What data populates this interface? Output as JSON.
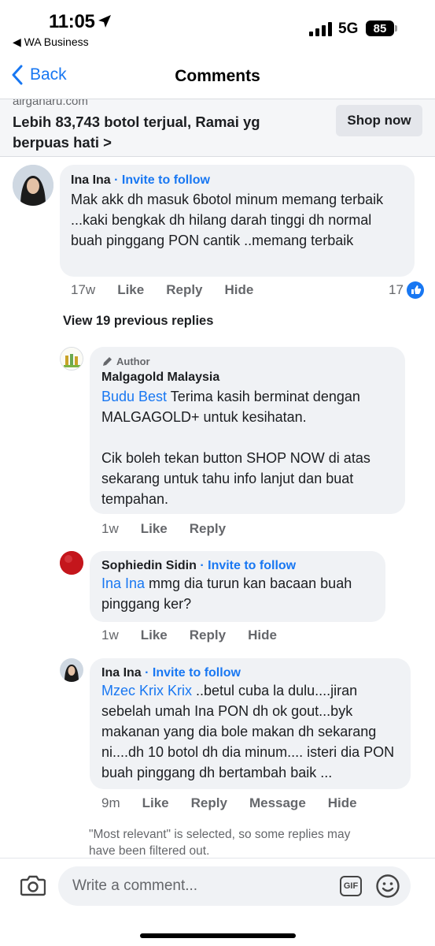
{
  "status_bar": {
    "time": "11:05",
    "back_app": "◀ WA Business",
    "network": "5G",
    "battery": "85"
  },
  "nav": {
    "back_label": "Back",
    "title": "Comments"
  },
  "ad": {
    "domain": "airganaru.com",
    "headline": "Lebih 83,743 botol terjual, Ramai yg berpuas hati  >",
    "button": "Shop now"
  },
  "comments": [
    {
      "name": "Ina Ina",
      "follow": "· Invite to follow",
      "text": "Mak akk dh masuk 6botol minum memang terbaik ...kaki bengkak dh hilang darah tinggi dh normal buah pinggang PON cantik ..memang terbaik",
      "time": "17w",
      "actions": [
        "Like",
        "Reply",
        "Hide"
      ],
      "like_count": "17"
    }
  ],
  "view_replies": "View 19 previous replies",
  "replies": [
    {
      "badge": "Author",
      "name": "Malgagold Malaysia",
      "mention": "Budu Best",
      "text_1": " Terima kasih berminat dengan MALGAGOLD+ untuk kesihatan.",
      "text_2": "Cik boleh tekan button SHOP NOW di atas sekarang untuk tahu info lanjut dan buat tempahan.",
      "time": "1w",
      "actions": [
        "Like",
        "Reply"
      ]
    },
    {
      "name": "Sophiedin Sidin",
      "follow": "· Invite to follow",
      "mention": "Ina Ina",
      "text": " mmg dia turun kan bacaan buah pinggang ker?",
      "time": "1w",
      "actions": [
        "Like",
        "Reply",
        "Hide"
      ]
    },
    {
      "name": "Ina Ina",
      "follow": "· Invite to follow",
      "mention": "Mzec Krix Krix",
      "text": " ..betul cuba la dulu....jiran sebelah umah Ina PON dh ok gout...byk makanan yang dia bole makan dh sekarang ni....dh 10 botol dh dia minum.... isteri dia PON buah pinggang dh bertambah baik ...",
      "time": "9m",
      "actions": [
        "Like",
        "Reply",
        "Message",
        "Hide"
      ]
    }
  ],
  "footnote": "\"Most relevant\" is selected, so some replies may have been filtered out.",
  "composer": {
    "placeholder": "Write a comment...",
    "gif_label": "GIF"
  },
  "colors": {
    "accent": "#1877f2",
    "bubble": "#f0f2f5",
    "meta": "#65676b"
  }
}
